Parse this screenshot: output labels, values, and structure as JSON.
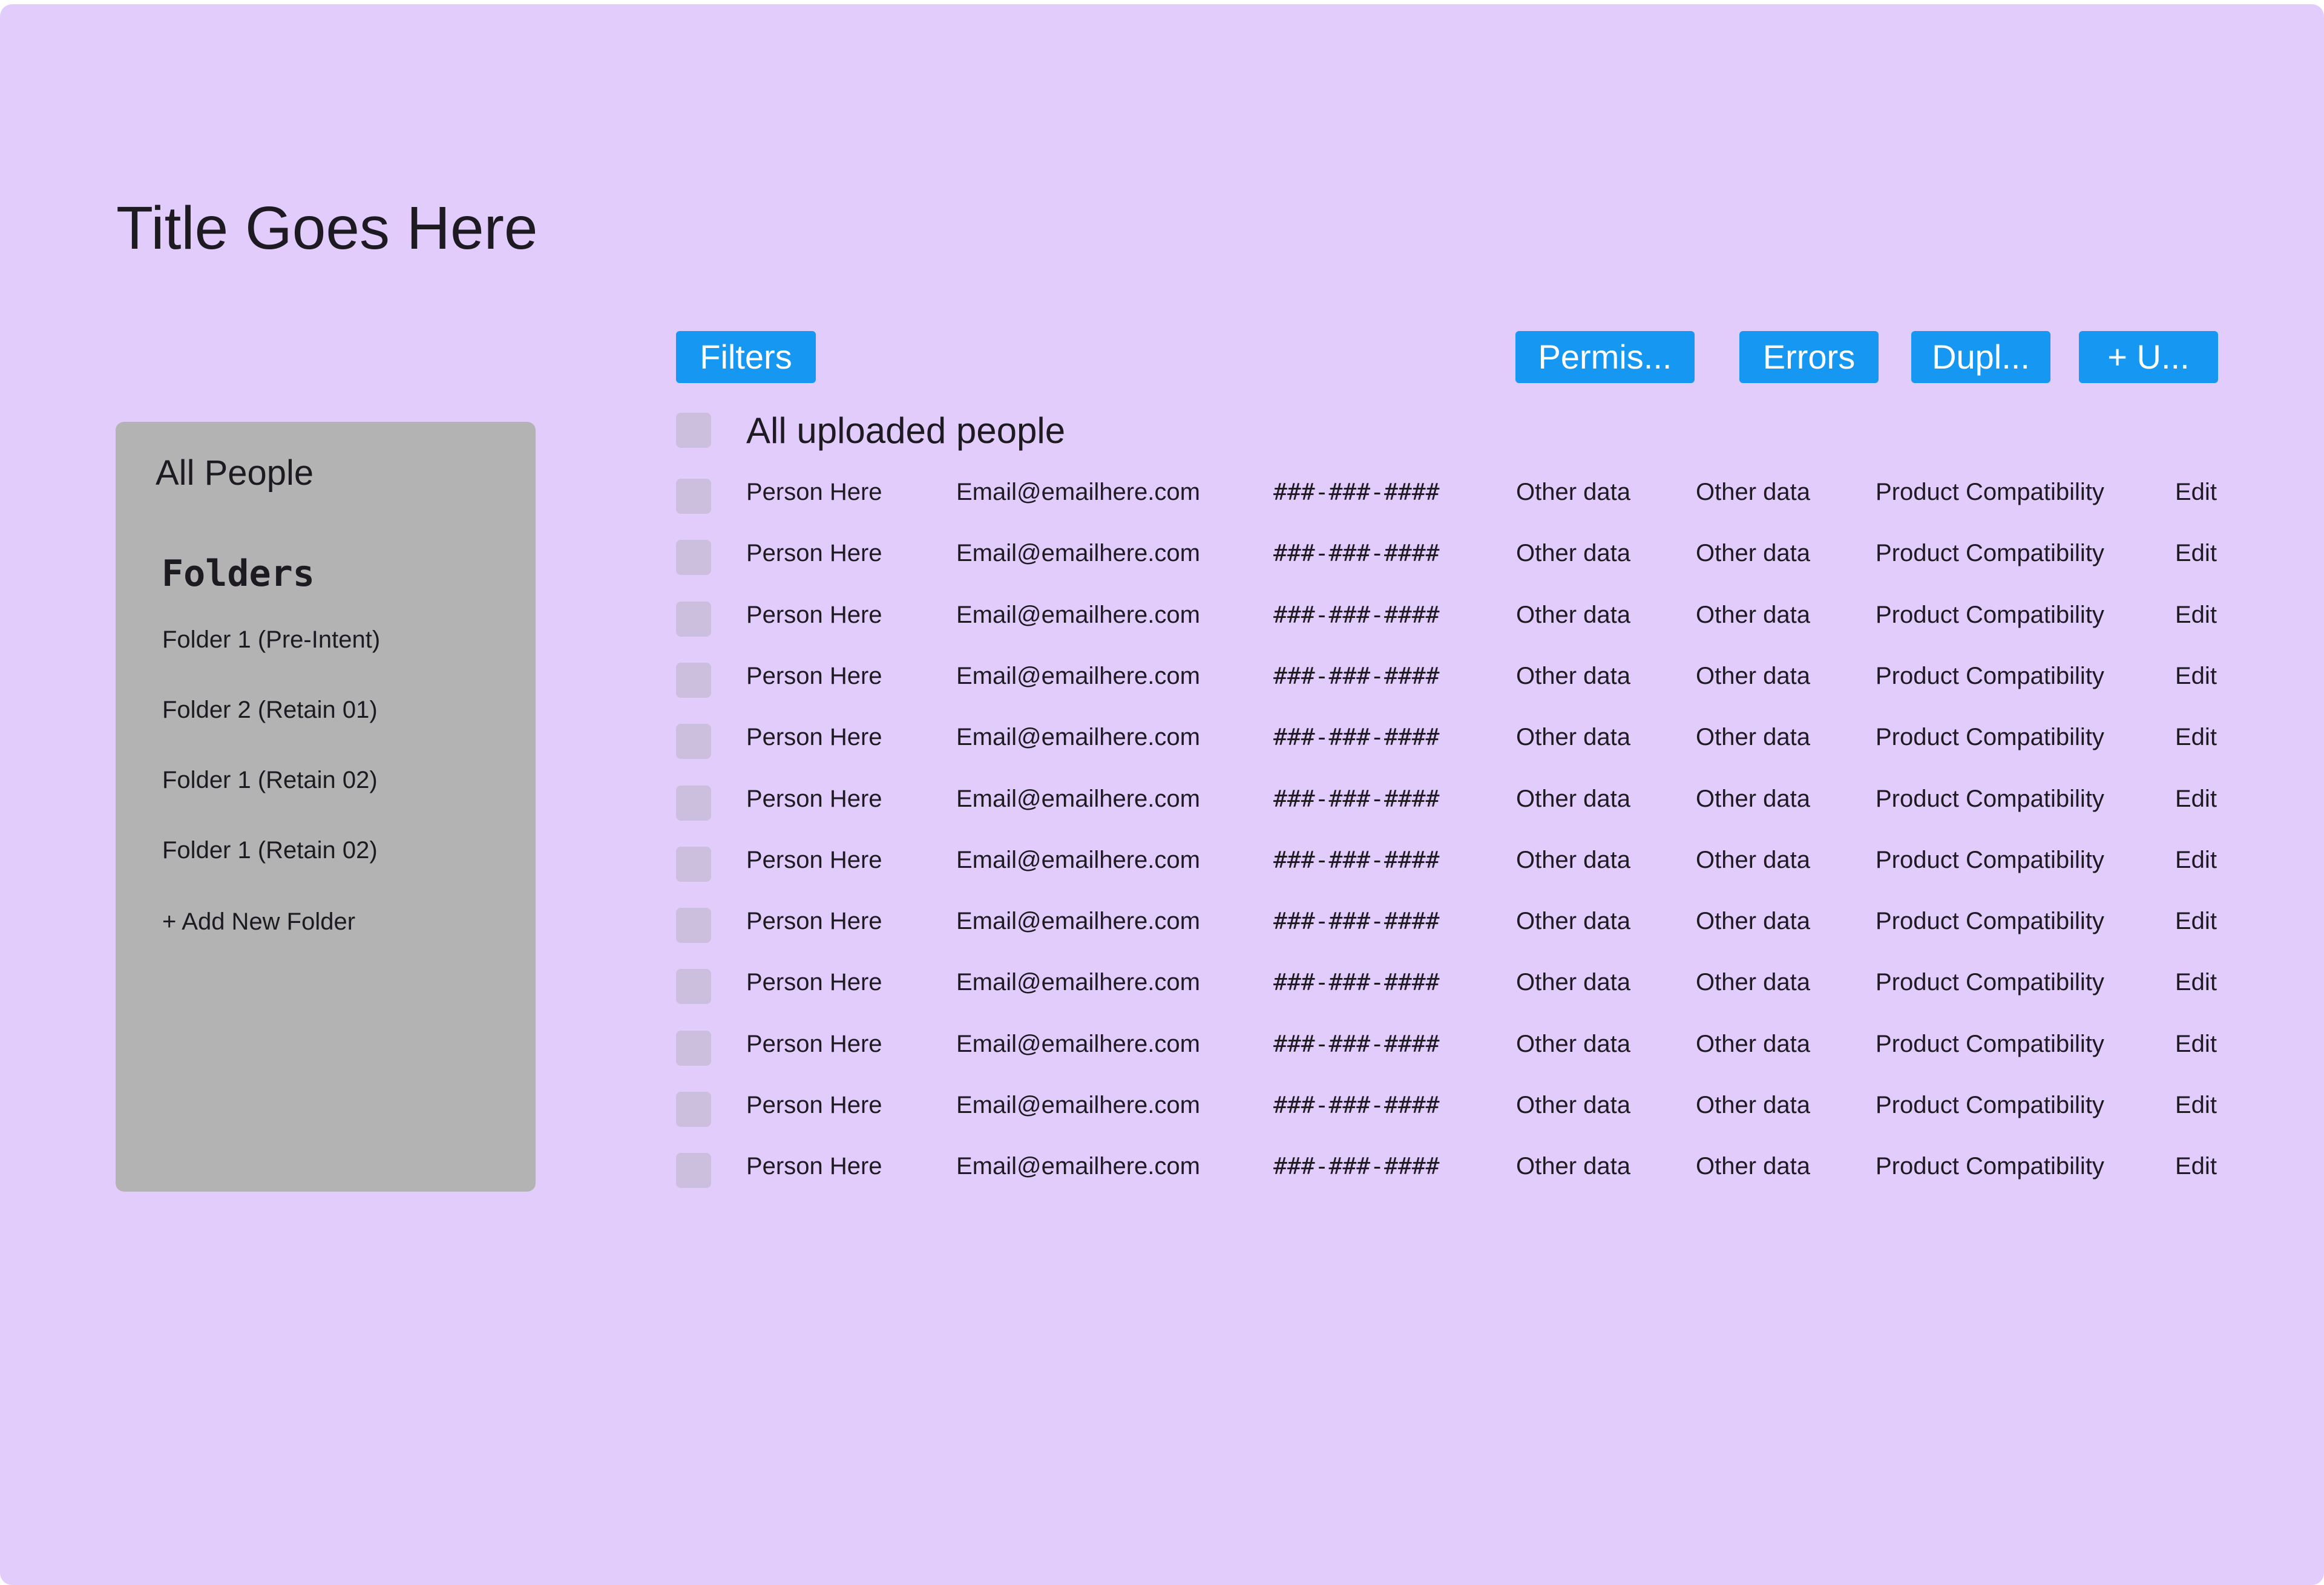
{
  "page": {
    "title": "Title Goes Here"
  },
  "sidebar": {
    "all_label": "All People",
    "folders_heading": "Folders",
    "items": [
      {
        "label": "Folder 1 (Pre-Intent)"
      },
      {
        "label": "Folder 2 (Retain 01)"
      },
      {
        "label": "Folder 1 (Retain 02)"
      },
      {
        "label": "Folder 1 (Retain 02)"
      },
      {
        "label": "+ Add New Folder"
      }
    ]
  },
  "toolbar": {
    "filters_label": "Filters",
    "permissions_label": "Permis...",
    "errors_label": "Errors",
    "duplicates_label": "Dupl...",
    "upload_label": "+ U..."
  },
  "table": {
    "select_all_label": "All uploaded people",
    "rows": [
      {
        "name": "Person Here",
        "email": "Email@emailhere.com",
        "phone": "###-###-####",
        "other1": "Other data",
        "other2": "Other data",
        "product": "Product Compatibility",
        "action": "Edit"
      },
      {
        "name": "Person Here",
        "email": "Email@emailhere.com",
        "phone": "###-###-####",
        "other1": "Other data",
        "other2": "Other data",
        "product": "Product Compatibility",
        "action": "Edit"
      },
      {
        "name": "Person Here",
        "email": "Email@emailhere.com",
        "phone": "###-###-####",
        "other1": "Other data",
        "other2": "Other data",
        "product": "Product Compatibility",
        "action": "Edit"
      },
      {
        "name": "Person Here",
        "email": "Email@emailhere.com",
        "phone": "###-###-####",
        "other1": "Other data",
        "other2": "Other data",
        "product": "Product Compatibility",
        "action": "Edit"
      },
      {
        "name": "Person Here",
        "email": "Email@emailhere.com",
        "phone": "###-###-####",
        "other1": "Other data",
        "other2": "Other data",
        "product": "Product Compatibility",
        "action": "Edit"
      },
      {
        "name": "Person Here",
        "email": "Email@emailhere.com",
        "phone": "###-###-####",
        "other1": "Other data",
        "other2": "Other data",
        "product": "Product Compatibility",
        "action": "Edit"
      },
      {
        "name": "Person Here",
        "email": "Email@emailhere.com",
        "phone": "###-###-####",
        "other1": "Other data",
        "other2": "Other data",
        "product": "Product Compatibility",
        "action": "Edit"
      },
      {
        "name": "Person Here",
        "email": "Email@emailhere.com",
        "phone": "###-###-####",
        "other1": "Other data",
        "other2": "Other data",
        "product": "Product Compatibility",
        "action": "Edit"
      },
      {
        "name": "Person Here",
        "email": "Email@emailhere.com",
        "phone": "###-###-####",
        "other1": "Other data",
        "other2": "Other data",
        "product": "Product Compatibility",
        "action": "Edit"
      },
      {
        "name": "Person Here",
        "email": "Email@emailhere.com",
        "phone": "###-###-####",
        "other1": "Other data",
        "other2": "Other data",
        "product": "Product Compatibility",
        "action": "Edit"
      },
      {
        "name": "Person Here",
        "email": "Email@emailhere.com",
        "phone": "###-###-####",
        "other1": "Other data",
        "other2": "Other data",
        "product": "Product Compatibility",
        "action": "Edit"
      },
      {
        "name": "Person Here",
        "email": "Email@emailhere.com",
        "phone": "###-###-####",
        "other1": "Other data",
        "other2": "Other data",
        "product": "Product Compatibility",
        "action": "Edit"
      }
    ]
  }
}
